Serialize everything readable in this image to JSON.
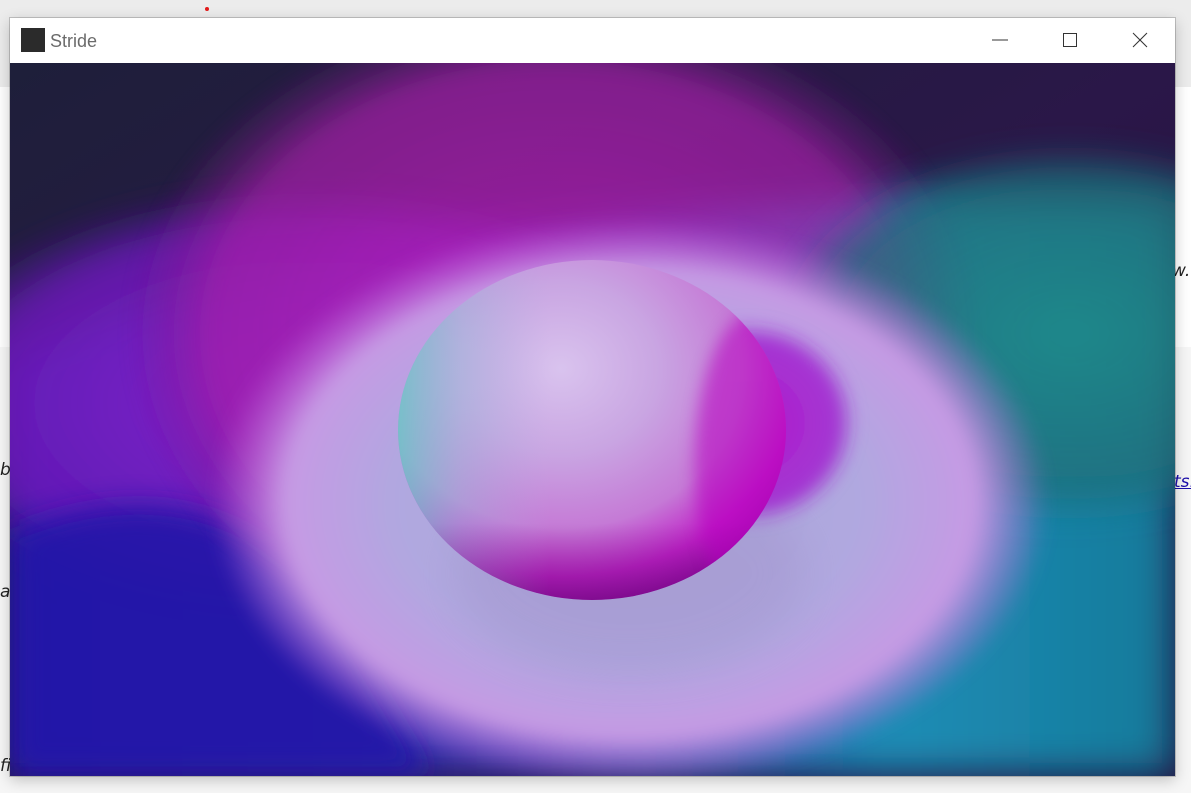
{
  "window": {
    "title": "Stride"
  },
  "background_fragments": [
    "w.",
    "b",
    "ts.",
    "a",
    "fi"
  ],
  "scene": {
    "palette": {
      "sky_top": "#1e1f3a",
      "deep_blue": "#2a1aa8",
      "magenta_light": "#c21fc0",
      "purple_light": "#7b1fc8",
      "teal_light": "#1f8f86",
      "cyan_floor": "#1a7fb0",
      "spot_lavender": "#b9a8e6",
      "sphere_highlight": "#d8c8ee",
      "sphere_magenta": "#c000c0",
      "sphere_teal": "#60d0c8"
    }
  }
}
